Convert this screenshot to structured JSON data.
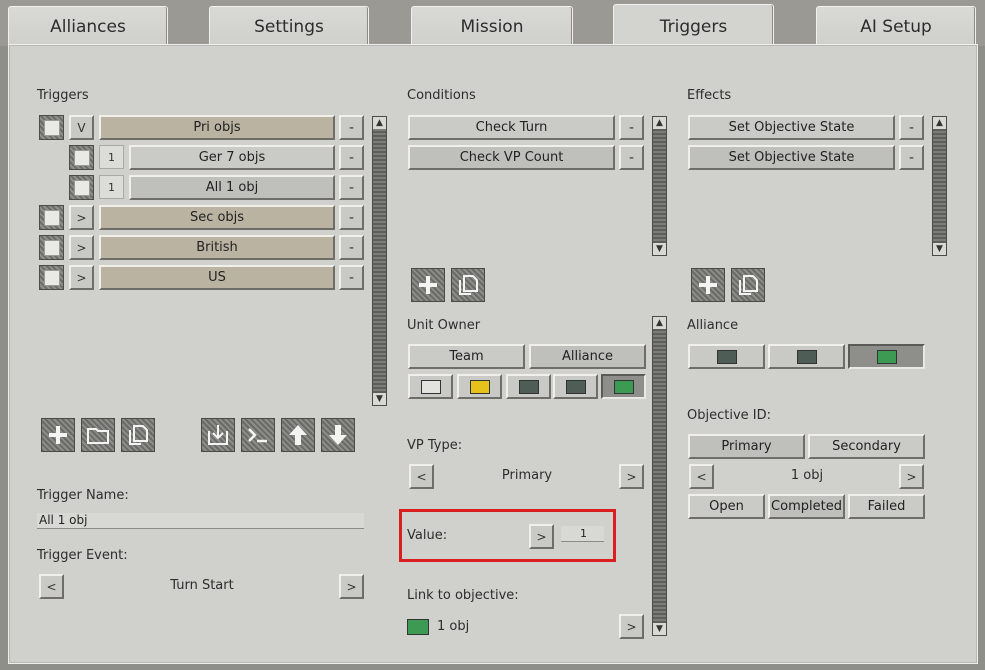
{
  "tabs": [
    "Alliances",
    "Settings",
    "Mission",
    "Triggers",
    "AI Setup"
  ],
  "active_tab": "Triggers",
  "triggers": {
    "heading": "Triggers",
    "rows": [
      {
        "toggle": "V",
        "label": "Pri objs",
        "dash": "-"
      },
      {
        "num": "1",
        "label": "Ger 7 objs",
        "dash": "-"
      },
      {
        "num": "1",
        "label": "All 1 obj",
        "dash": "-"
      },
      {
        "toggle": ">",
        "label": "Sec objs",
        "dash": "-"
      },
      {
        "toggle": ">",
        "label": "British",
        "dash": "-"
      },
      {
        "toggle": ">",
        "label": "US",
        "dash": "-"
      }
    ],
    "name_label": "Trigger Name:",
    "name_value": "All 1 obj",
    "event_label": "Trigger Event:",
    "event_value": "Turn Start",
    "prev": "<",
    "next": ">"
  },
  "conditions": {
    "heading": "Conditions",
    "items": [
      "Check Turn",
      "Check VP Count"
    ],
    "dash": "-",
    "unit_owner_label": "Unit Owner",
    "team_label": "Team",
    "alliance_label": "Alliance",
    "owner_colors": [
      "#e2e2de",
      "#e6c21a",
      "#4e5e56",
      "#4e5e56",
      "#3c9a52"
    ],
    "vp_type_label": "VP Type:",
    "vp_type_value": "Primary",
    "prev": "<",
    "next": ">",
    "value_label": "Value:",
    "value_btn": ">",
    "value": "1",
    "link_label": "Link to objective:",
    "link_value": "1 obj",
    "link_color": "#3c9a52"
  },
  "effects": {
    "heading": "Effects",
    "items": [
      "Set Objective State",
      "Set Objective State"
    ],
    "dash": "-",
    "alliance_label": "Alliance",
    "alliance_colors": [
      "#4e5e56",
      "#4e5e56",
      "#3c9a52"
    ],
    "objective_id_label": "Objective ID:",
    "primary_label": "Primary",
    "secondary_label": "Secondary",
    "objective_value": "1 obj",
    "prev": "<",
    "next": ">",
    "states": [
      "Open",
      "Completed",
      "Failed"
    ]
  },
  "colors": {
    "highlight": "#d91f1f",
    "panel": "#d0d0cc",
    "tan_bar": "#bab3a2"
  }
}
